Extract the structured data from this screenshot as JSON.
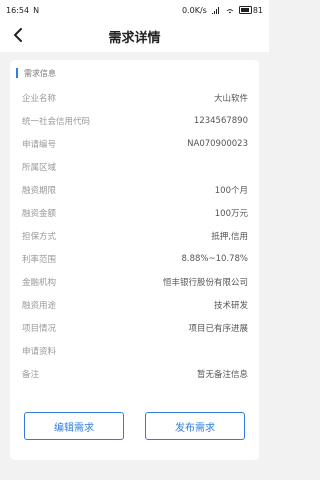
{
  "status": {
    "time": "16:54",
    "carrier": "N",
    "network": "0.0K/s",
    "battery": "81"
  },
  "header": {
    "title": "需求详情"
  },
  "section": {
    "title": "需求信息"
  },
  "rows": [
    {
      "label": "企业名称",
      "value": "大山软件"
    },
    {
      "label": "统一社会信用代码",
      "value": "1234567890"
    },
    {
      "label": "申请编号",
      "value": "NA070900023"
    },
    {
      "label": "所属区域",
      "value": ""
    },
    {
      "label": "融资期限",
      "value": "100个月"
    },
    {
      "label": "融资金额",
      "value": "100万元"
    },
    {
      "label": "担保方式",
      "value": "抵押,信用"
    },
    {
      "label": "利率范围",
      "value": "8.88%~10.78%"
    },
    {
      "label": "金融机构",
      "value": "恒丰银行股份有限公司"
    },
    {
      "label": "融资用途",
      "value": "技术研发"
    },
    {
      "label": "项目情况",
      "value": "项目已有序进展"
    },
    {
      "label": "申请资料",
      "value": ""
    },
    {
      "label": "备注",
      "value": "暂无备注信息"
    }
  ],
  "actions": {
    "edit_label": "编辑需求",
    "publish_label": "发布需求"
  },
  "colors": {
    "accent": "#2f7de1"
  }
}
